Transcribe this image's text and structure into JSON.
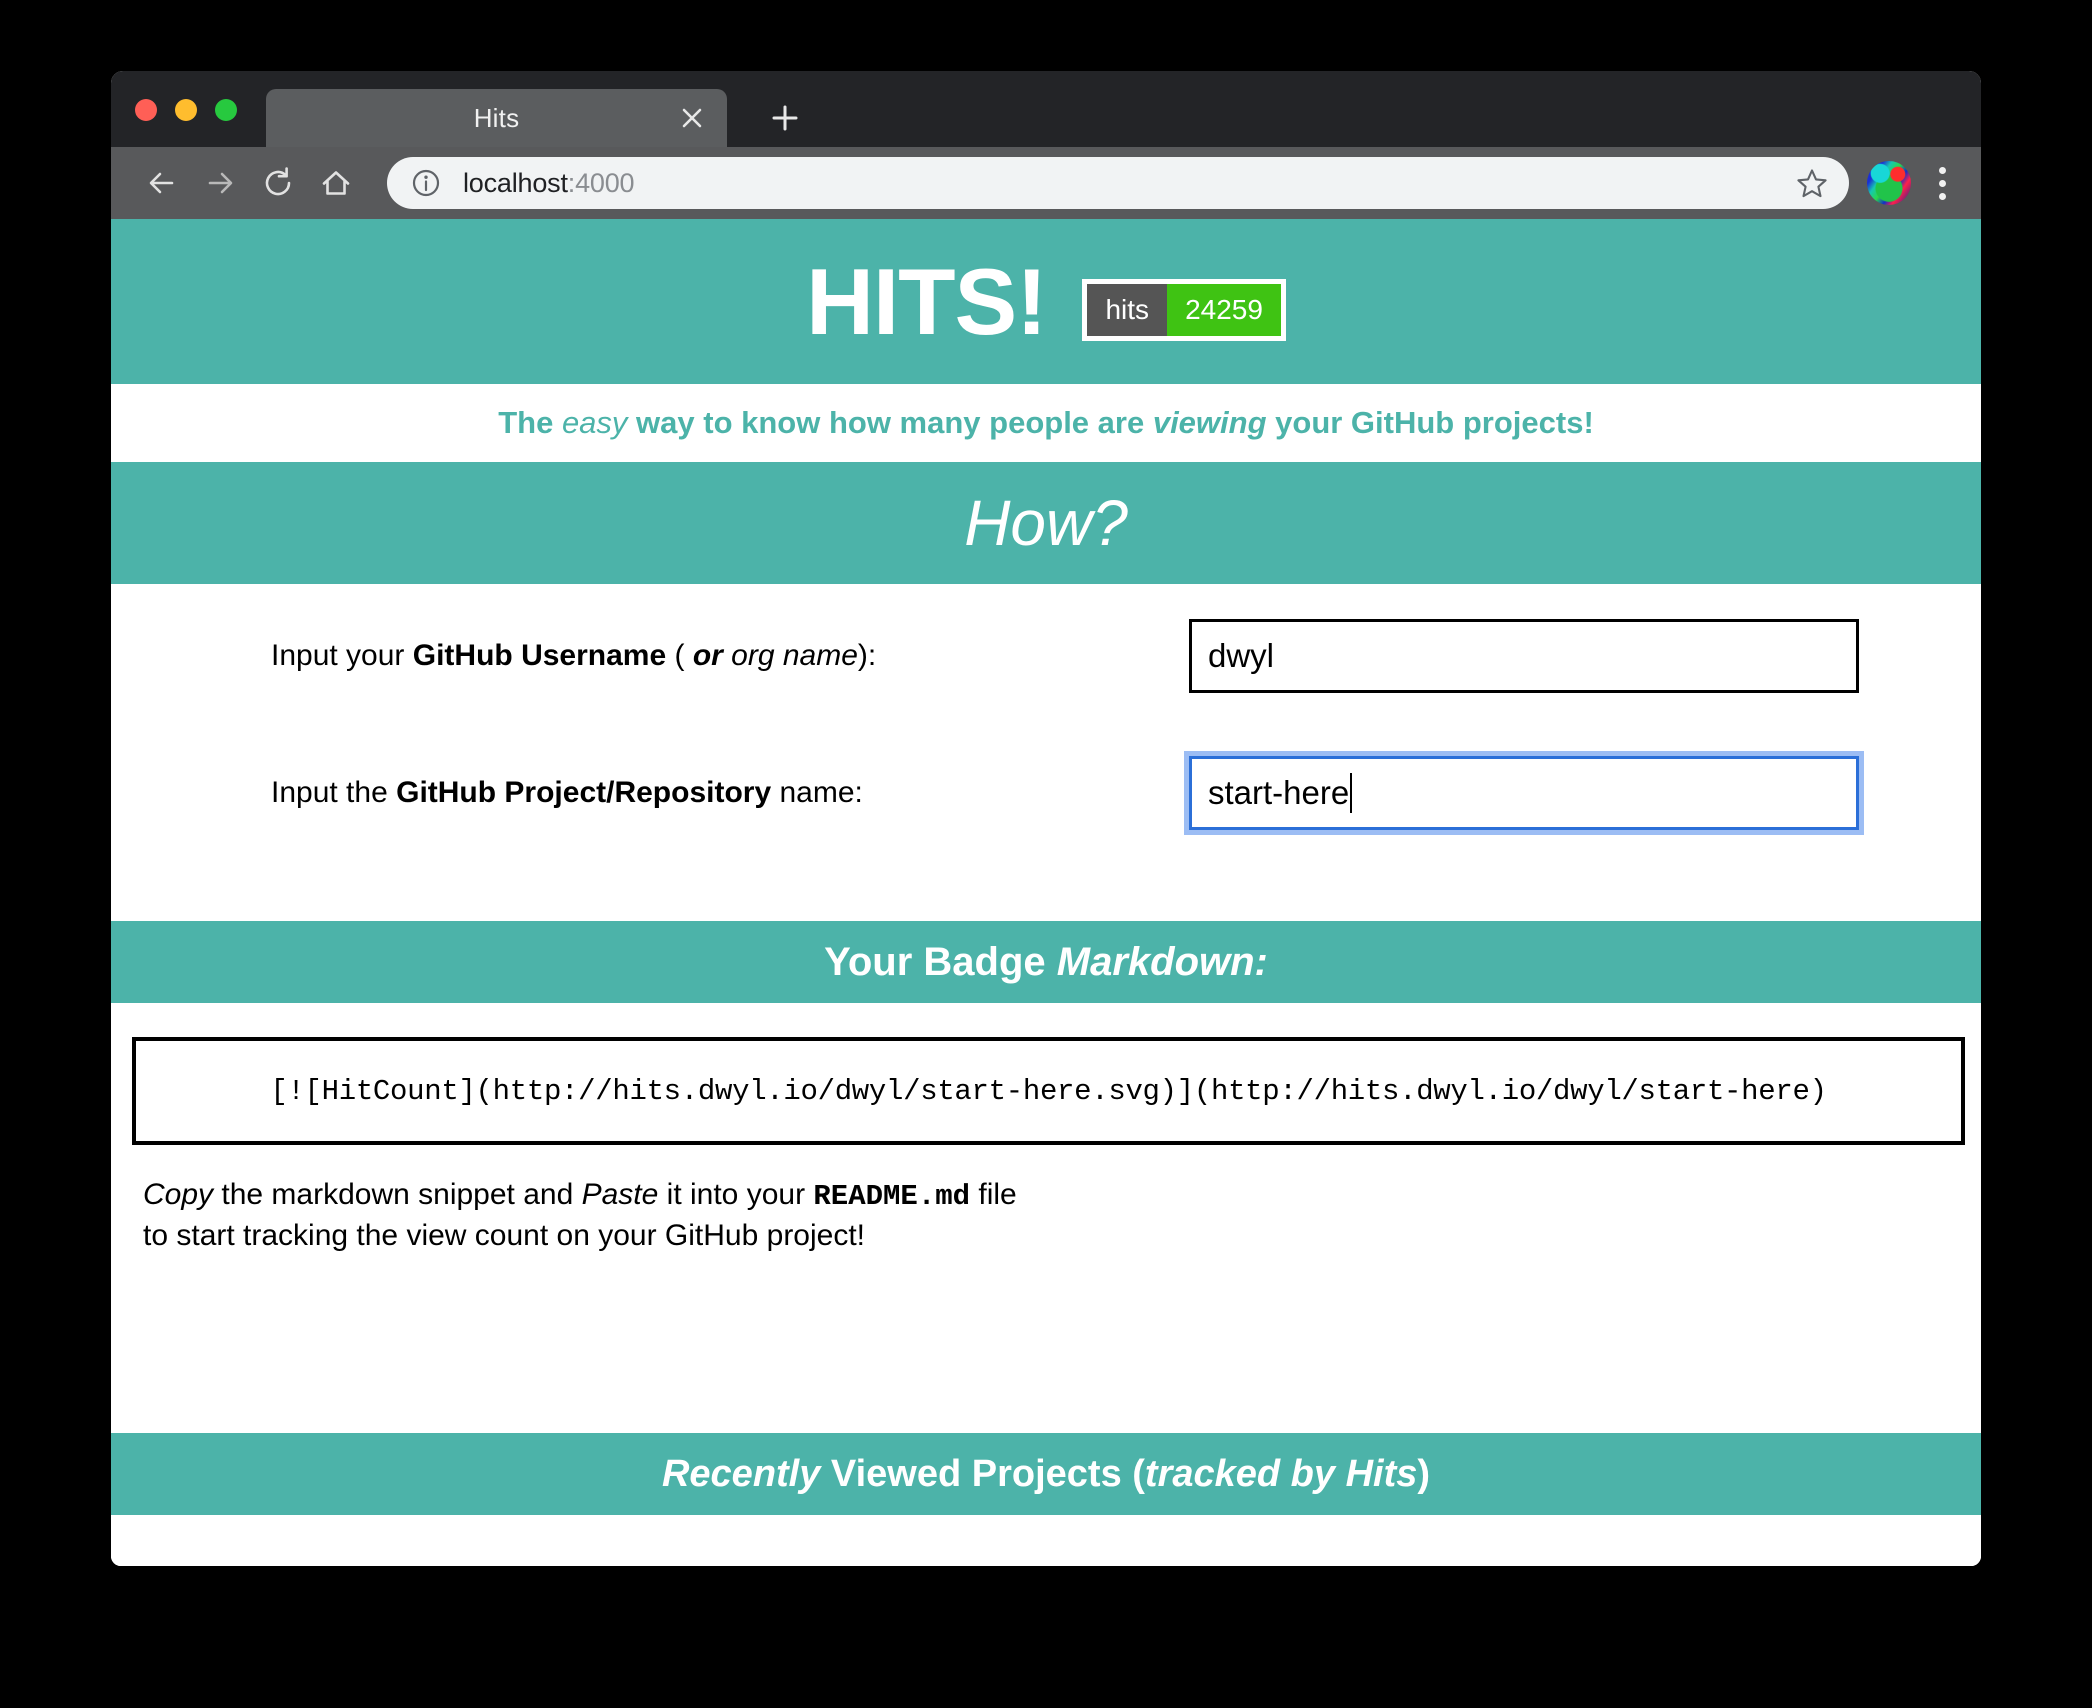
{
  "browser": {
    "tab": {
      "title": "Hits",
      "close_icon": "close-icon"
    },
    "new_tab_icon": "plus-icon",
    "toolbar": {
      "back_icon": "arrow-left-icon",
      "forward_icon": "arrow-right-icon",
      "reload_icon": "reload-icon",
      "home_icon": "home-icon",
      "site_info_icon": "info-circle-icon",
      "url_host": "localhost",
      "url_port": ":4000",
      "bookmark_icon": "star-icon",
      "avatar_icon": "profile-avatar",
      "menu_icon": "three-dots-icon"
    },
    "traffic_lights": {
      "close": "close-window-button",
      "minimize": "minimize-window-button",
      "maximize": "maximize-window-button"
    }
  },
  "page": {
    "hero": {
      "title": "HITS!",
      "badge": {
        "label": "hits",
        "count": "24259",
        "label_color": "#555555",
        "count_color": "#3fc313"
      }
    },
    "tagline": {
      "part1": "The ",
      "italic1": "easy",
      "part2": " way to know how many people are ",
      "bolditalic1": "viewing",
      "part3": " your GitHub projects!"
    },
    "how": {
      "title": "How?"
    },
    "form": {
      "username": {
        "label_part1": "Input your ",
        "label_bold": "GitHub Username",
        "label_part2": " ( ",
        "label_bolditalic": "or",
        "label_italic": " org name",
        "label_part3": "):",
        "value": "dwyl",
        "placeholder": "dwyl"
      },
      "repo": {
        "label_part1": "Input the ",
        "label_bold": "GitHub Project/Repository",
        "label_part2": " name:",
        "value": "start-here",
        "placeholder": "start-here"
      }
    },
    "badge_markdown": {
      "title_bold": "Your Badge ",
      "title_bolditalic": "Markdown:",
      "snippet": "[![HitCount](http://hits.dwyl.io/dwyl/start-here.svg)](http://hits.dwyl.io/dwyl/start-here)",
      "help_italic1": "Copy",
      "help_part1": " the markdown snippet and ",
      "help_italic2": "Paste",
      "help_part2": " it into your ",
      "help_mono": "README.md",
      "help_part3": " file",
      "help_line2": "to start tracking the view count on your GitHub project!"
    },
    "recent": {
      "title_italic1": "Recently",
      "title_part1": " Viewed Projects (",
      "title_italic2": "tracked by Hits",
      "title_part2": ")"
    },
    "theme": {
      "teal": "#4cb3a9",
      "white": "#ffffff",
      "focus_blue": "#2b6fd8"
    }
  }
}
